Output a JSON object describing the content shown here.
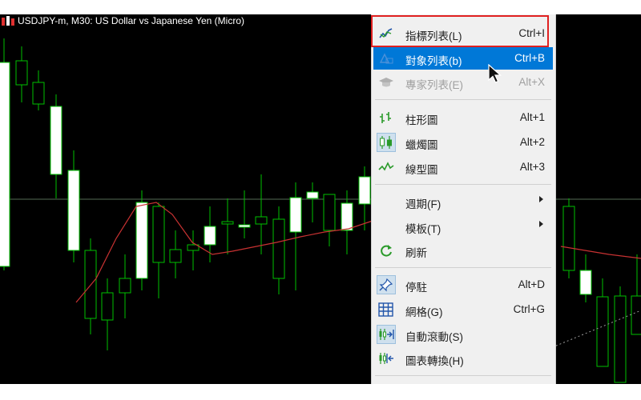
{
  "chart": {
    "title": "USDJPY-m, M30:  US Dollar vs Japanese Yen (Micro)",
    "colors": {
      "background": "#000000",
      "candle": "#00c000",
      "ma": "#c83232",
      "hline": "#556b55"
    }
  },
  "menu": {
    "items": [
      {
        "label": "指標列表(L)",
        "shortcut": "Ctrl+I",
        "icon": "indicator-list-icon",
        "state": "normal"
      },
      {
        "label": "對象列表(b)",
        "shortcut": "Ctrl+B",
        "icon": "objects-list-icon",
        "state": "selected"
      },
      {
        "label": "專家列表(E)",
        "shortcut": "Alt+X",
        "icon": "expert-cap-icon",
        "state": "disabled"
      },
      {
        "label": "柱形圖",
        "shortcut": "Alt+1",
        "icon": "bar-chart-icon",
        "state": "normal"
      },
      {
        "label": "蠟燭圖",
        "shortcut": "Alt+2",
        "icon": "candlestick-icon",
        "state": "pressed"
      },
      {
        "label": "線型圖",
        "shortcut": "Alt+3",
        "icon": "line-chart-icon",
        "state": "normal"
      },
      {
        "label": "週期(F)",
        "shortcut": "",
        "icon": "",
        "state": "submenu"
      },
      {
        "label": "模板(T)",
        "shortcut": "",
        "icon": "",
        "state": "submenu"
      },
      {
        "label": "刷新",
        "shortcut": "",
        "icon": "refresh-icon",
        "state": "normal"
      },
      {
        "label": "停駐",
        "shortcut": "Alt+D",
        "icon": "pin-icon",
        "state": "pressed"
      },
      {
        "label": "網格(G)",
        "shortcut": "Ctrl+G",
        "icon": "grid-icon",
        "state": "normal"
      },
      {
        "label": "自動滾動(S)",
        "shortcut": "",
        "icon": "auto-scroll-icon",
        "state": "pressed"
      },
      {
        "label": "圖表轉換(H)",
        "shortcut": "",
        "icon": "chart-shift-icon",
        "state": "normal"
      }
    ],
    "highlight_color": "#e02020",
    "selected_color": "#0078d7"
  }
}
